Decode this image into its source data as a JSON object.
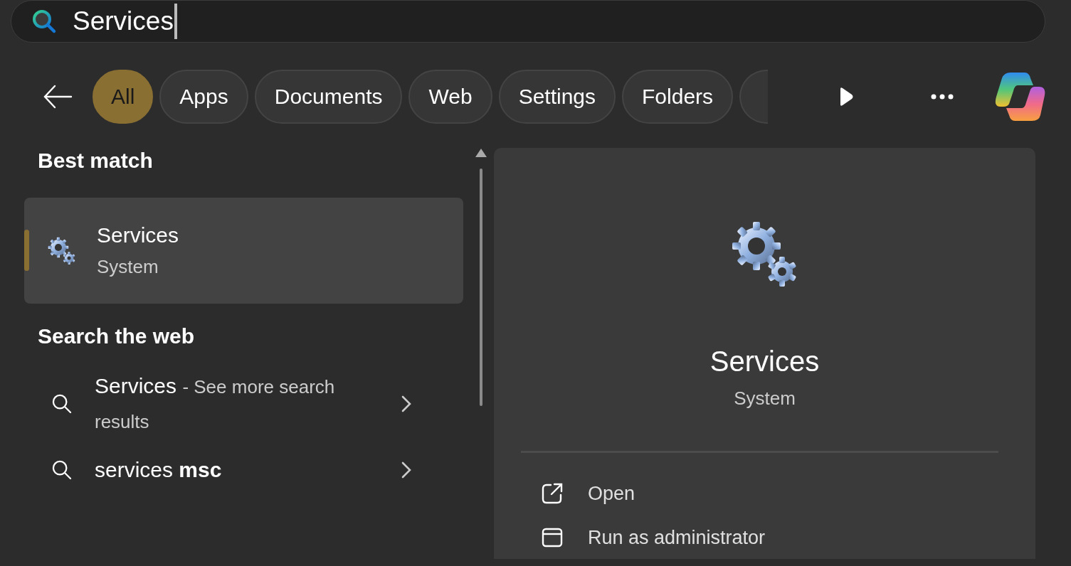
{
  "search": {
    "value": "Services"
  },
  "filters": {
    "tabs": [
      {
        "label": "All",
        "selected": true
      },
      {
        "label": "Apps",
        "selected": false
      },
      {
        "label": "Documents",
        "selected": false
      },
      {
        "label": "Web",
        "selected": false
      },
      {
        "label": "Settings",
        "selected": false
      },
      {
        "label": "Folders",
        "selected": false
      }
    ]
  },
  "best_match": {
    "heading": "Best match",
    "items": [
      {
        "title": "Services",
        "subtitle": "System",
        "selected": true
      }
    ]
  },
  "web": {
    "heading": "Search the web",
    "items": [
      {
        "kind": "suggestion",
        "title": "Services",
        "detail": "- See more search results"
      },
      {
        "kind": "query",
        "text": "services **msc**"
      }
    ]
  },
  "preview": {
    "title": "Services",
    "subtitle": "System",
    "actions": [
      {
        "kind": "open",
        "label": "Open"
      },
      {
        "kind": "admin",
        "label": "Run as administrator"
      }
    ]
  }
}
